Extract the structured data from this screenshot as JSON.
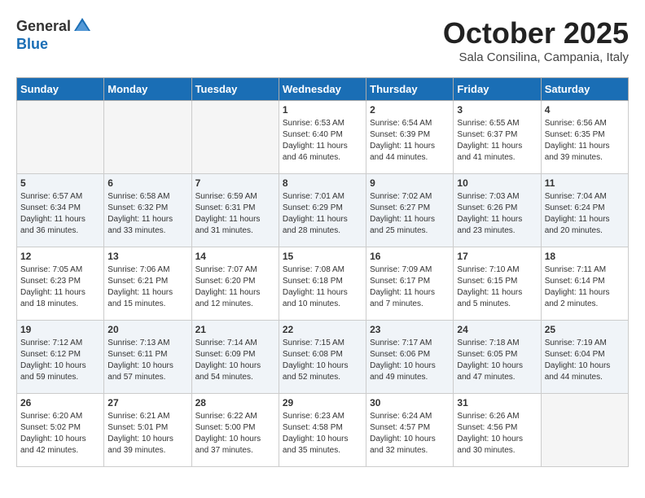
{
  "logo": {
    "general": "General",
    "blue": "Blue"
  },
  "title": "October 2025",
  "location": "Sala Consilina, Campania, Italy",
  "weekdays": [
    "Sunday",
    "Monday",
    "Tuesday",
    "Wednesday",
    "Thursday",
    "Friday",
    "Saturday"
  ],
  "weeks": [
    [
      {
        "day": "",
        "info": ""
      },
      {
        "day": "",
        "info": ""
      },
      {
        "day": "",
        "info": ""
      },
      {
        "day": "1",
        "info": "Sunrise: 6:53 AM\nSunset: 6:40 PM\nDaylight: 11 hours and 46 minutes."
      },
      {
        "day": "2",
        "info": "Sunrise: 6:54 AM\nSunset: 6:39 PM\nDaylight: 11 hours and 44 minutes."
      },
      {
        "day": "3",
        "info": "Sunrise: 6:55 AM\nSunset: 6:37 PM\nDaylight: 11 hours and 41 minutes."
      },
      {
        "day": "4",
        "info": "Sunrise: 6:56 AM\nSunset: 6:35 PM\nDaylight: 11 hours and 39 minutes."
      }
    ],
    [
      {
        "day": "5",
        "info": "Sunrise: 6:57 AM\nSunset: 6:34 PM\nDaylight: 11 hours and 36 minutes."
      },
      {
        "day": "6",
        "info": "Sunrise: 6:58 AM\nSunset: 6:32 PM\nDaylight: 11 hours and 33 minutes."
      },
      {
        "day": "7",
        "info": "Sunrise: 6:59 AM\nSunset: 6:31 PM\nDaylight: 11 hours and 31 minutes."
      },
      {
        "day": "8",
        "info": "Sunrise: 7:01 AM\nSunset: 6:29 PM\nDaylight: 11 hours and 28 minutes."
      },
      {
        "day": "9",
        "info": "Sunrise: 7:02 AM\nSunset: 6:27 PM\nDaylight: 11 hours and 25 minutes."
      },
      {
        "day": "10",
        "info": "Sunrise: 7:03 AM\nSunset: 6:26 PM\nDaylight: 11 hours and 23 minutes."
      },
      {
        "day": "11",
        "info": "Sunrise: 7:04 AM\nSunset: 6:24 PM\nDaylight: 11 hours and 20 minutes."
      }
    ],
    [
      {
        "day": "12",
        "info": "Sunrise: 7:05 AM\nSunset: 6:23 PM\nDaylight: 11 hours and 18 minutes."
      },
      {
        "day": "13",
        "info": "Sunrise: 7:06 AM\nSunset: 6:21 PM\nDaylight: 11 hours and 15 minutes."
      },
      {
        "day": "14",
        "info": "Sunrise: 7:07 AM\nSunset: 6:20 PM\nDaylight: 11 hours and 12 minutes."
      },
      {
        "day": "15",
        "info": "Sunrise: 7:08 AM\nSunset: 6:18 PM\nDaylight: 11 hours and 10 minutes."
      },
      {
        "day": "16",
        "info": "Sunrise: 7:09 AM\nSunset: 6:17 PM\nDaylight: 11 hours and 7 minutes."
      },
      {
        "day": "17",
        "info": "Sunrise: 7:10 AM\nSunset: 6:15 PM\nDaylight: 11 hours and 5 minutes."
      },
      {
        "day": "18",
        "info": "Sunrise: 7:11 AM\nSunset: 6:14 PM\nDaylight: 11 hours and 2 minutes."
      }
    ],
    [
      {
        "day": "19",
        "info": "Sunrise: 7:12 AM\nSunset: 6:12 PM\nDaylight: 10 hours and 59 minutes."
      },
      {
        "day": "20",
        "info": "Sunrise: 7:13 AM\nSunset: 6:11 PM\nDaylight: 10 hours and 57 minutes."
      },
      {
        "day": "21",
        "info": "Sunrise: 7:14 AM\nSunset: 6:09 PM\nDaylight: 10 hours and 54 minutes."
      },
      {
        "day": "22",
        "info": "Sunrise: 7:15 AM\nSunset: 6:08 PM\nDaylight: 10 hours and 52 minutes."
      },
      {
        "day": "23",
        "info": "Sunrise: 7:17 AM\nSunset: 6:06 PM\nDaylight: 10 hours and 49 minutes."
      },
      {
        "day": "24",
        "info": "Sunrise: 7:18 AM\nSunset: 6:05 PM\nDaylight: 10 hours and 47 minutes."
      },
      {
        "day": "25",
        "info": "Sunrise: 7:19 AM\nSunset: 6:04 PM\nDaylight: 10 hours and 44 minutes."
      }
    ],
    [
      {
        "day": "26",
        "info": "Sunrise: 6:20 AM\nSunset: 5:02 PM\nDaylight: 10 hours and 42 minutes."
      },
      {
        "day": "27",
        "info": "Sunrise: 6:21 AM\nSunset: 5:01 PM\nDaylight: 10 hours and 39 minutes."
      },
      {
        "day": "28",
        "info": "Sunrise: 6:22 AM\nSunset: 5:00 PM\nDaylight: 10 hours and 37 minutes."
      },
      {
        "day": "29",
        "info": "Sunrise: 6:23 AM\nSunset: 4:58 PM\nDaylight: 10 hours and 35 minutes."
      },
      {
        "day": "30",
        "info": "Sunrise: 6:24 AM\nSunset: 4:57 PM\nDaylight: 10 hours and 32 minutes."
      },
      {
        "day": "31",
        "info": "Sunrise: 6:26 AM\nSunset: 4:56 PM\nDaylight: 10 hours and 30 minutes."
      },
      {
        "day": "",
        "info": ""
      }
    ]
  ]
}
